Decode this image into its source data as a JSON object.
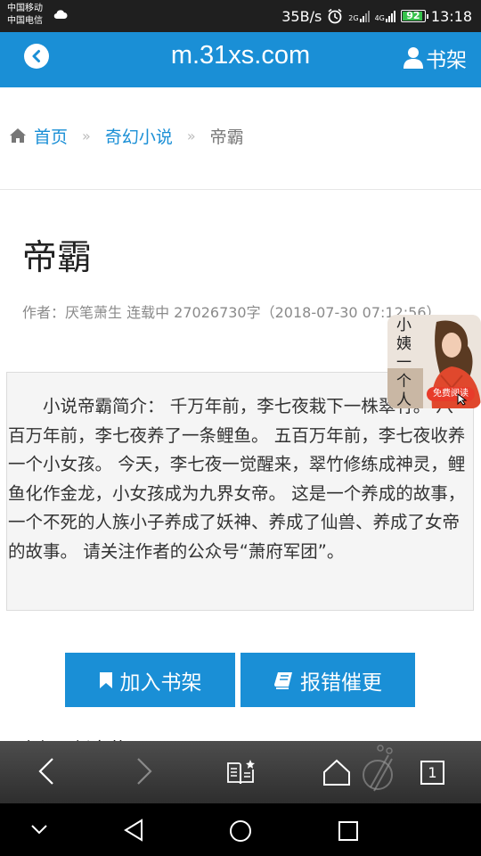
{
  "status_bar": {
    "carrier_1": "中国移动",
    "carrier_2": "中国电信",
    "net_speed": "35B/s",
    "net_2g": "2G",
    "net_4g": "4G",
    "battery": "92",
    "time": "13:18"
  },
  "header": {
    "site_title": "m.31xs.com",
    "back_icon": "chevron-left-circle-icon",
    "bookshelf_label": "书架",
    "bookshelf_icon": "user-icon"
  },
  "breadcrumb": {
    "home": "首页",
    "category": "奇幻小说",
    "current": "帝霸",
    "separator": "»"
  },
  "book": {
    "title": "帝霸",
    "meta": "作者：厌笔萧生 连载中 27026730字（2018-07-30 07:12:56）",
    "intro": "小说帝霸简介： 千万年前，李七夜栽下一株翠竹。 八百万年前，李七夜养了一条鲤鱼。 五百万年前，李七夜收养一个小女孩。 今天，李七夜一觉醒来，翠竹修练成神灵，鲤鱼化作金龙，小女孩成为九界女帝。 这是一个养成的故事，一个不死的人族小子养成了妖神、养成了仙兽、养成了女帝的故事。 请关注作者的公众号“萧府军团”。"
  },
  "ad": {
    "text": "小姨一个人在家",
    "button": "免费阅读"
  },
  "actions": {
    "add_shelf": "加入书架",
    "report": "报错催更"
  },
  "next_section": "全部最新章节",
  "browser": {
    "tab_count": "1"
  },
  "colors": {
    "accent": "#1a8fd6",
    "ad_button": "#e83b2a",
    "battery": "#36c24b"
  }
}
